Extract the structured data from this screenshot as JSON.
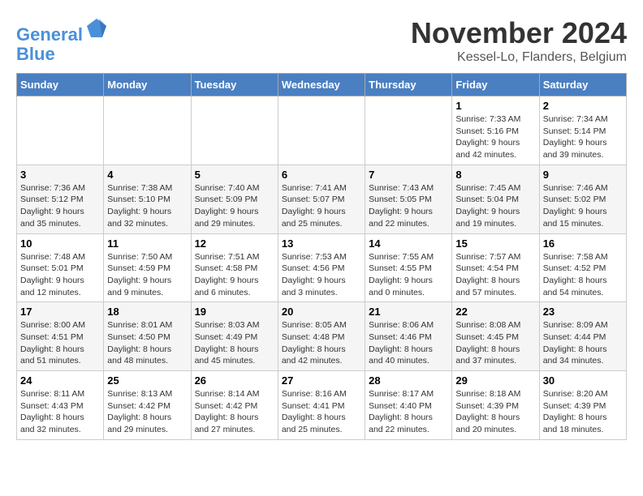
{
  "logo": {
    "line1": "General",
    "line2": "Blue"
  },
  "title": "November 2024",
  "location": "Kessel-Lo, Flanders, Belgium",
  "weekdays": [
    "Sunday",
    "Monday",
    "Tuesday",
    "Wednesday",
    "Thursday",
    "Friday",
    "Saturday"
  ],
  "weeks": [
    [
      {
        "day": "",
        "sunrise": "",
        "sunset": "",
        "daylight": ""
      },
      {
        "day": "",
        "sunrise": "",
        "sunset": "",
        "daylight": ""
      },
      {
        "day": "",
        "sunrise": "",
        "sunset": "",
        "daylight": ""
      },
      {
        "day": "",
        "sunrise": "",
        "sunset": "",
        "daylight": ""
      },
      {
        "day": "",
        "sunrise": "",
        "sunset": "",
        "daylight": ""
      },
      {
        "day": "1",
        "sunrise": "Sunrise: 7:33 AM",
        "sunset": "Sunset: 5:16 PM",
        "daylight": "Daylight: 9 hours and 42 minutes."
      },
      {
        "day": "2",
        "sunrise": "Sunrise: 7:34 AM",
        "sunset": "Sunset: 5:14 PM",
        "daylight": "Daylight: 9 hours and 39 minutes."
      }
    ],
    [
      {
        "day": "3",
        "sunrise": "Sunrise: 7:36 AM",
        "sunset": "Sunset: 5:12 PM",
        "daylight": "Daylight: 9 hours and 35 minutes."
      },
      {
        "day": "4",
        "sunrise": "Sunrise: 7:38 AM",
        "sunset": "Sunset: 5:10 PM",
        "daylight": "Daylight: 9 hours and 32 minutes."
      },
      {
        "day": "5",
        "sunrise": "Sunrise: 7:40 AM",
        "sunset": "Sunset: 5:09 PM",
        "daylight": "Daylight: 9 hours and 29 minutes."
      },
      {
        "day": "6",
        "sunrise": "Sunrise: 7:41 AM",
        "sunset": "Sunset: 5:07 PM",
        "daylight": "Daylight: 9 hours and 25 minutes."
      },
      {
        "day": "7",
        "sunrise": "Sunrise: 7:43 AM",
        "sunset": "Sunset: 5:05 PM",
        "daylight": "Daylight: 9 hours and 22 minutes."
      },
      {
        "day": "8",
        "sunrise": "Sunrise: 7:45 AM",
        "sunset": "Sunset: 5:04 PM",
        "daylight": "Daylight: 9 hours and 19 minutes."
      },
      {
        "day": "9",
        "sunrise": "Sunrise: 7:46 AM",
        "sunset": "Sunset: 5:02 PM",
        "daylight": "Daylight: 9 hours and 15 minutes."
      }
    ],
    [
      {
        "day": "10",
        "sunrise": "Sunrise: 7:48 AM",
        "sunset": "Sunset: 5:01 PM",
        "daylight": "Daylight: 9 hours and 12 minutes."
      },
      {
        "day": "11",
        "sunrise": "Sunrise: 7:50 AM",
        "sunset": "Sunset: 4:59 PM",
        "daylight": "Daylight: 9 hours and 9 minutes."
      },
      {
        "day": "12",
        "sunrise": "Sunrise: 7:51 AM",
        "sunset": "Sunset: 4:58 PM",
        "daylight": "Daylight: 9 hours and 6 minutes."
      },
      {
        "day": "13",
        "sunrise": "Sunrise: 7:53 AM",
        "sunset": "Sunset: 4:56 PM",
        "daylight": "Daylight: 9 hours and 3 minutes."
      },
      {
        "day": "14",
        "sunrise": "Sunrise: 7:55 AM",
        "sunset": "Sunset: 4:55 PM",
        "daylight": "Daylight: 9 hours and 0 minutes."
      },
      {
        "day": "15",
        "sunrise": "Sunrise: 7:57 AM",
        "sunset": "Sunset: 4:54 PM",
        "daylight": "Daylight: 8 hours and 57 minutes."
      },
      {
        "day": "16",
        "sunrise": "Sunrise: 7:58 AM",
        "sunset": "Sunset: 4:52 PM",
        "daylight": "Daylight: 8 hours and 54 minutes."
      }
    ],
    [
      {
        "day": "17",
        "sunrise": "Sunrise: 8:00 AM",
        "sunset": "Sunset: 4:51 PM",
        "daylight": "Daylight: 8 hours and 51 minutes."
      },
      {
        "day": "18",
        "sunrise": "Sunrise: 8:01 AM",
        "sunset": "Sunset: 4:50 PM",
        "daylight": "Daylight: 8 hours and 48 minutes."
      },
      {
        "day": "19",
        "sunrise": "Sunrise: 8:03 AM",
        "sunset": "Sunset: 4:49 PM",
        "daylight": "Daylight: 8 hours and 45 minutes."
      },
      {
        "day": "20",
        "sunrise": "Sunrise: 8:05 AM",
        "sunset": "Sunset: 4:48 PM",
        "daylight": "Daylight: 8 hours and 42 minutes."
      },
      {
        "day": "21",
        "sunrise": "Sunrise: 8:06 AM",
        "sunset": "Sunset: 4:46 PM",
        "daylight": "Daylight: 8 hours and 40 minutes."
      },
      {
        "day": "22",
        "sunrise": "Sunrise: 8:08 AM",
        "sunset": "Sunset: 4:45 PM",
        "daylight": "Daylight: 8 hours and 37 minutes."
      },
      {
        "day": "23",
        "sunrise": "Sunrise: 8:09 AM",
        "sunset": "Sunset: 4:44 PM",
        "daylight": "Daylight: 8 hours and 34 minutes."
      }
    ],
    [
      {
        "day": "24",
        "sunrise": "Sunrise: 8:11 AM",
        "sunset": "Sunset: 4:43 PM",
        "daylight": "Daylight: 8 hours and 32 minutes."
      },
      {
        "day": "25",
        "sunrise": "Sunrise: 8:13 AM",
        "sunset": "Sunset: 4:42 PM",
        "daylight": "Daylight: 8 hours and 29 minutes."
      },
      {
        "day": "26",
        "sunrise": "Sunrise: 8:14 AM",
        "sunset": "Sunset: 4:42 PM",
        "daylight": "Daylight: 8 hours and 27 minutes."
      },
      {
        "day": "27",
        "sunrise": "Sunrise: 8:16 AM",
        "sunset": "Sunset: 4:41 PM",
        "daylight": "Daylight: 8 hours and 25 minutes."
      },
      {
        "day": "28",
        "sunrise": "Sunrise: 8:17 AM",
        "sunset": "Sunset: 4:40 PM",
        "daylight": "Daylight: 8 hours and 22 minutes."
      },
      {
        "day": "29",
        "sunrise": "Sunrise: 8:18 AM",
        "sunset": "Sunset: 4:39 PM",
        "daylight": "Daylight: 8 hours and 20 minutes."
      },
      {
        "day": "30",
        "sunrise": "Sunrise: 8:20 AM",
        "sunset": "Sunset: 4:39 PM",
        "daylight": "Daylight: 8 hours and 18 minutes."
      }
    ]
  ]
}
